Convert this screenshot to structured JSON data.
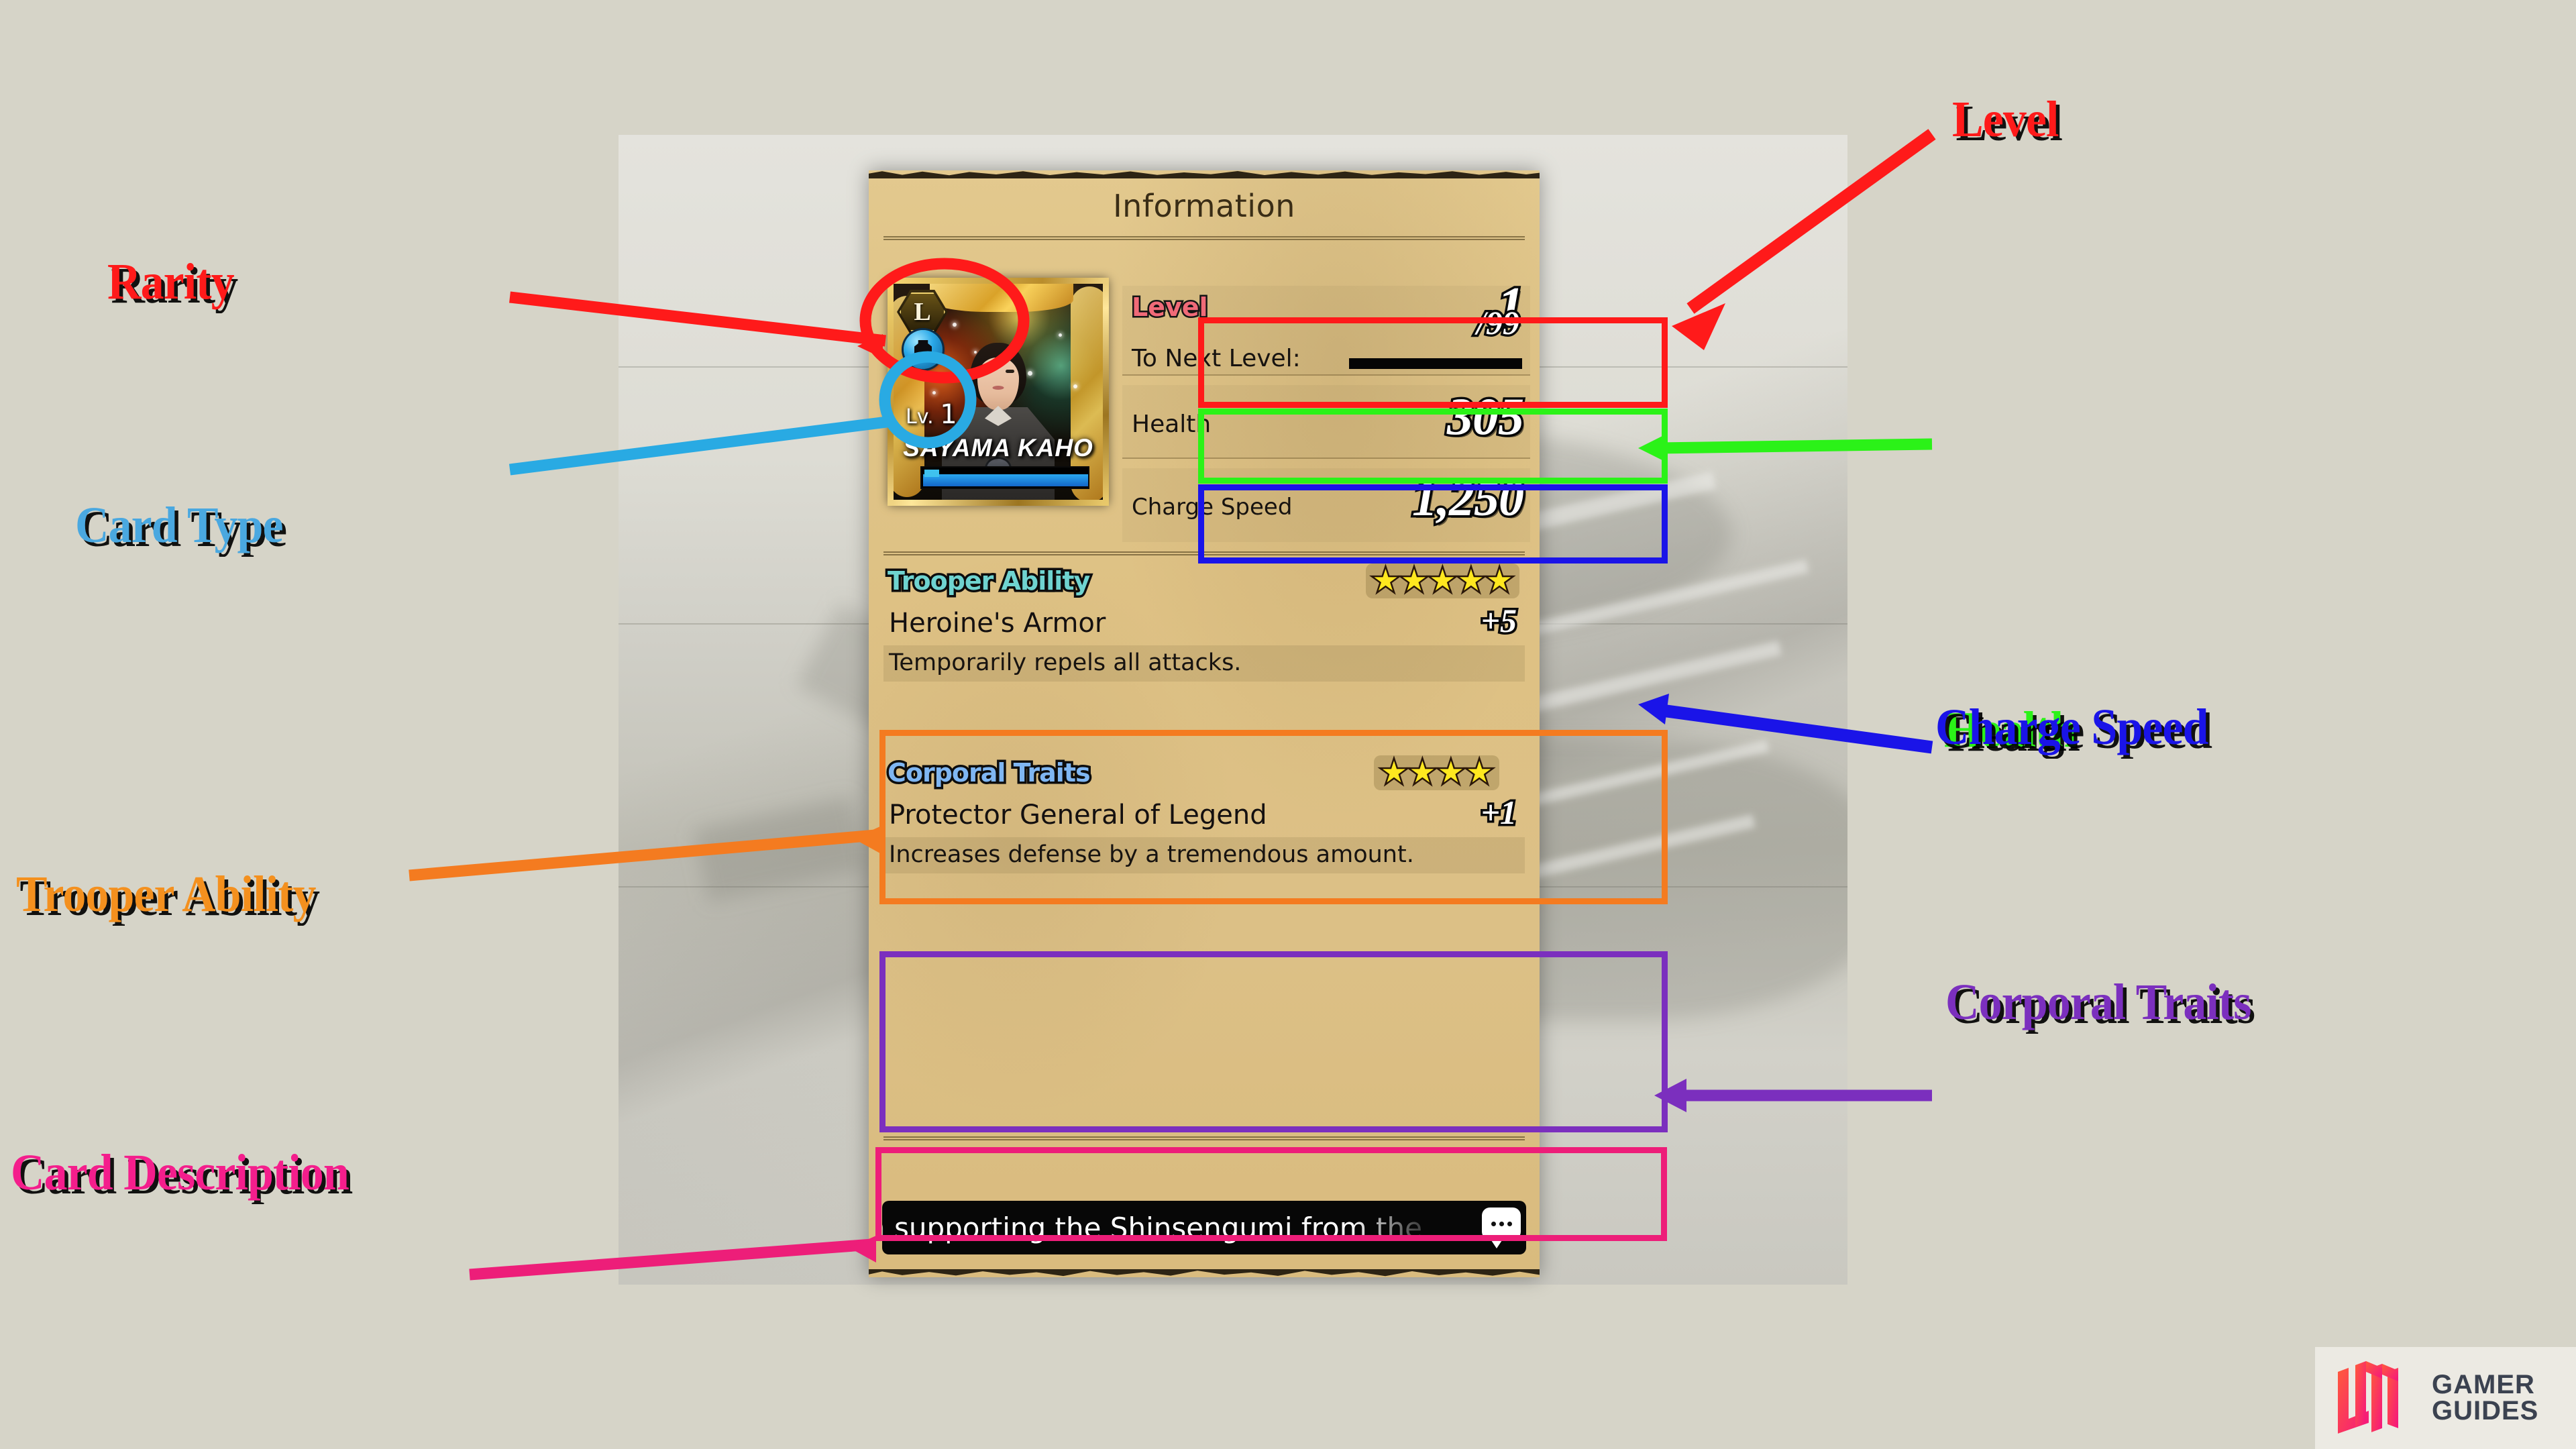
{
  "background_color": "#d6d4c8",
  "annotations": [
    {
      "id": "rarity",
      "label": "Rarity",
      "color": "#ff1a1a",
      "side": "left"
    },
    {
      "id": "card-type",
      "label": "Card Type",
      "color": "#29aae3",
      "side": "left"
    },
    {
      "id": "trooper",
      "label": "Trooper Ability",
      "color": "#f47b20",
      "side": "left"
    },
    {
      "id": "card-desc",
      "label": "Card Description",
      "color": "#ed1e79",
      "side": "left"
    },
    {
      "id": "level",
      "label": "Level",
      "color": "#ff1a1a",
      "side": "right"
    },
    {
      "id": "health",
      "label": "Health",
      "color": "#2bf218",
      "side": "right"
    },
    {
      "id": "charge-speed",
      "label": "Charge Speed",
      "color": "#1a14e8",
      "side": "right"
    },
    {
      "id": "corporal",
      "label": "Corporal Traits",
      "color": "#7b2fbe",
      "side": "right"
    }
  ],
  "game": {
    "panel_title": "Information",
    "card": {
      "rarity": "L",
      "card_type_icon": "armor-vest-icon",
      "level_prefix": "Lv.",
      "level_number": "1",
      "character_name": "SAYAMA KAHO"
    },
    "stats": {
      "level_label": "Level",
      "level_value": "1",
      "level_separator": "/",
      "level_max": "99",
      "to_next_level_label": "To Next Level:",
      "to_next_level_progress": 0,
      "health_label": "Health",
      "health_value": "305",
      "charge_speed_label": "Charge Speed",
      "charge_speed_value": "1,250"
    },
    "trooper_ability": {
      "heading": "Trooper Ability",
      "heading_color": "#6fd3d0",
      "stars": 5,
      "name": "Heroine's Armor",
      "bonus": "+5",
      "description": "Temporarily repels all attacks."
    },
    "corporal_traits": {
      "heading": "Corporal Traits",
      "heading_color": "#7fb6f2",
      "stars": 4,
      "name": "Protector General of Legend",
      "bonus": "+1",
      "description": "Increases defense by a tremendous amount."
    },
    "card_description": {
      "visible_text": "n supporting the Shinsengumi from the",
      "icon": "speech-bubble-icon"
    }
  },
  "watermark": {
    "line1": "GAMER",
    "line2": "GUIDES",
    "logo": "4-in-1-glyph-logo"
  }
}
